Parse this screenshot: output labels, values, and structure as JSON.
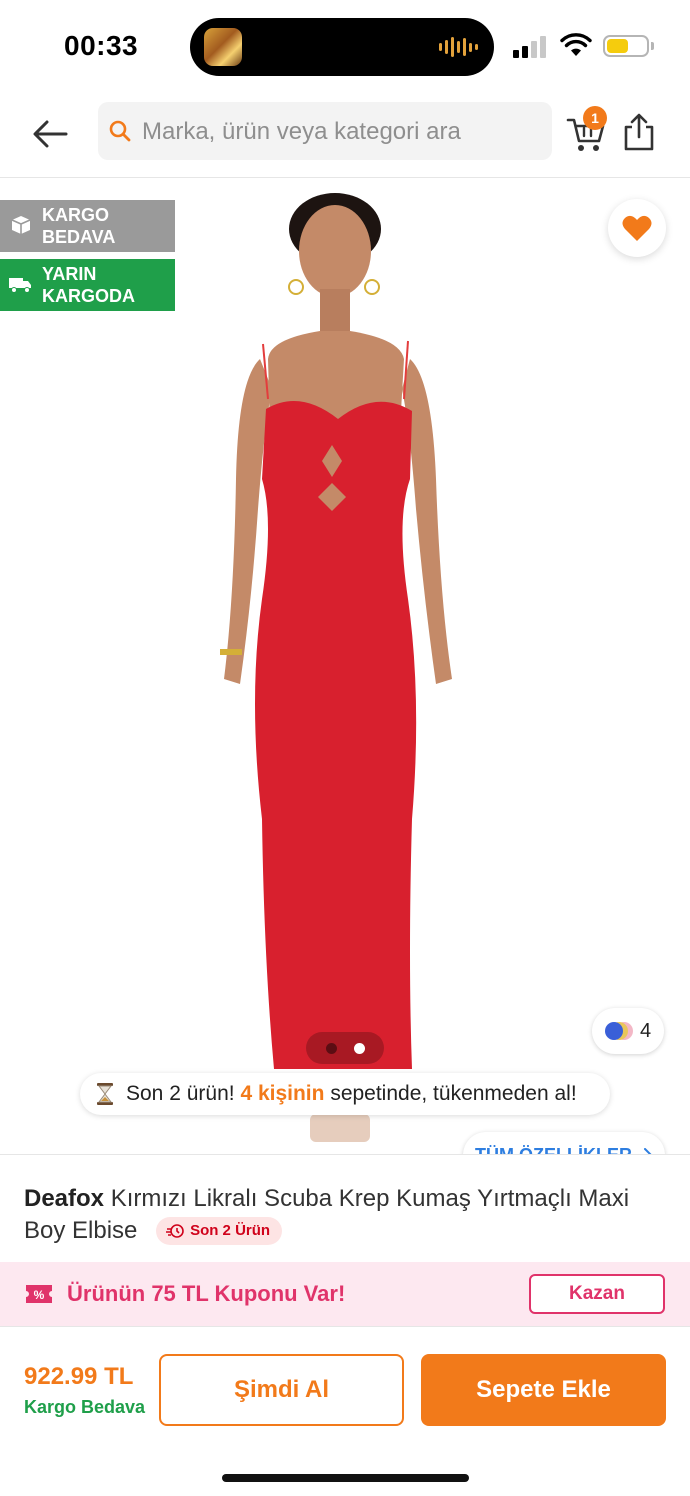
{
  "status_bar": {
    "time": "00:33",
    "battery_level": 0.55
  },
  "header": {
    "search_placeholder": "Marka, ürün veya kategori ara",
    "cart_count": "1"
  },
  "gallery": {
    "badges": [
      {
        "text": "KARGO BEDAVA",
        "color": "#9a9a9a",
        "icon": "box-icon"
      },
      {
        "text": "YARIN KARGODA",
        "color": "#1f9f4a",
        "icon": "delivery-truck-icon"
      }
    ],
    "dress_color": "#d8202e",
    "color_count": "4",
    "image_count": 2,
    "active_image": 2,
    "stock_banner": {
      "prefix": "Son 2 ürün!",
      "highlight": "4 kişinin",
      "suffix": "sepetinde, tükenmeden al!"
    },
    "all_features_label": "TÜM ÖZELLİKLER"
  },
  "product": {
    "brand": "Deafox",
    "name": "Kırmızı Likralı Scuba Krep Kumaş Yırtmaçlı Maxi Boy Elbise",
    "stock_chip": "Son 2 Ürün"
  },
  "coupon": {
    "text": "Ürünün 75 TL Kuponu Var!",
    "button": "Kazan"
  },
  "actions": {
    "price": "922.99 TL",
    "shipping": "Kargo Bedava",
    "buy_now": "Şimdi Al",
    "add_to_cart": "Sepete Ekle"
  },
  "colors": {
    "accent": "#f27a1a",
    "green": "#1f9f4a",
    "pink": "#e0336a",
    "link_blue": "#2e7ee0"
  }
}
